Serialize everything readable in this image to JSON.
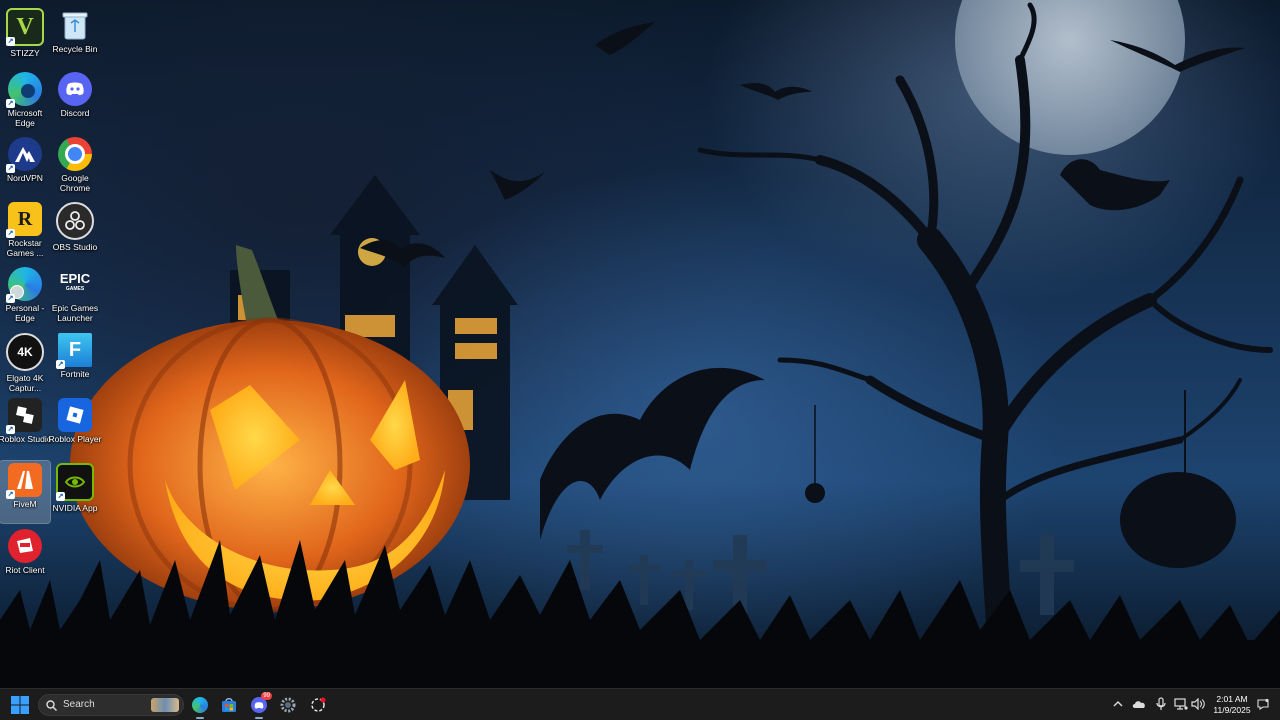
{
  "desktop": {
    "icons": [
      {
        "label": "STIZZY"
      },
      {
        "label": "Recycle Bin"
      },
      {
        "label": "Microsoft Edge"
      },
      {
        "label": "Discord"
      },
      {
        "label": "NordVPN"
      },
      {
        "label": "Google Chrome"
      },
      {
        "label": "Rockstar Games ..."
      },
      {
        "label": "OBS Studio"
      },
      {
        "label": "Personal - Edge"
      },
      {
        "label": "Epic Games Launcher"
      },
      {
        "label": "Elgato 4K Captur..."
      },
      {
        "label": "Fortnite"
      },
      {
        "label": "Roblox Studio"
      },
      {
        "label": "Roblox Player"
      },
      {
        "label": "FiveM"
      },
      {
        "label": "NVIDIA App"
      },
      {
        "label": "Riot Client"
      }
    ],
    "glyphs": {
      "stizzy": "V",
      "rockstar": "R",
      "epic": "EPIC",
      "epic_sub": "GAMES",
      "elgato": "4K",
      "fortnite": "F"
    }
  },
  "taskbar": {
    "search_placeholder": "Search",
    "discord_badge": "99"
  },
  "clock": {
    "time": "2:01 AM",
    "date": "11/9/2025"
  },
  "colors": {
    "taskbar_bg": "#1c1c1c",
    "windows_blue": "#3aa0ff",
    "discord": "#5865f2",
    "pumpkin": "#e86a1c"
  }
}
